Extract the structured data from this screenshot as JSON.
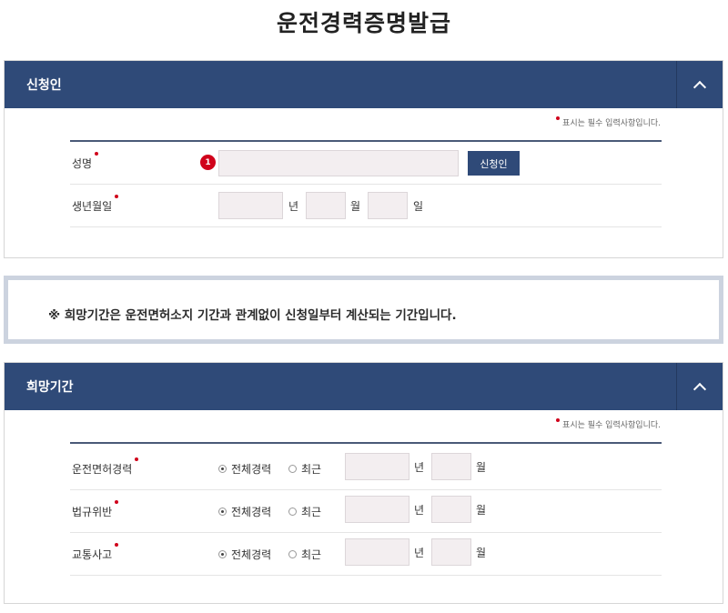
{
  "page": {
    "title": "운전경력증명발급"
  },
  "required_note": "표시는 필수 입력사항입니다.",
  "applicant": {
    "header": "신청인",
    "name_label": "성명",
    "name_value": "",
    "step_badge": "1",
    "applicant_button": "신청인",
    "birth_label": "생년월일",
    "birth_year": "",
    "birth_month": "",
    "birth_day": "",
    "unit_year": "년",
    "unit_month": "월",
    "unit_day": "일"
  },
  "notice": {
    "text": "※ 희망기간은 운전면허소지 기간과 관계없이 신청일부터 계산되는 기간입니다."
  },
  "period": {
    "header": "희망기간",
    "rows": [
      {
        "label": "운전면허경력",
        "opt_all": "전체경력",
        "opt_recent": "최근",
        "selected": "all",
        "year": "",
        "month": "",
        "unit_year": "년",
        "unit_month": "월"
      },
      {
        "label": "법규위반",
        "opt_all": "전체경력",
        "opt_recent": "최근",
        "selected": "all",
        "year": "",
        "month": "",
        "unit_year": "년",
        "unit_month": "월"
      },
      {
        "label": "교통사고",
        "opt_all": "전체경력",
        "opt_recent": "최근",
        "selected": "all",
        "year": "",
        "month": "",
        "unit_year": "년",
        "unit_month": "월"
      }
    ]
  },
  "colors": {
    "header_bg": "#2f4a78",
    "required_dot": "#d0021b",
    "input_bg": "#f3eef0"
  },
  "icons": {
    "collapse": "chevron-up-icon",
    "required": "required-dot-icon"
  }
}
